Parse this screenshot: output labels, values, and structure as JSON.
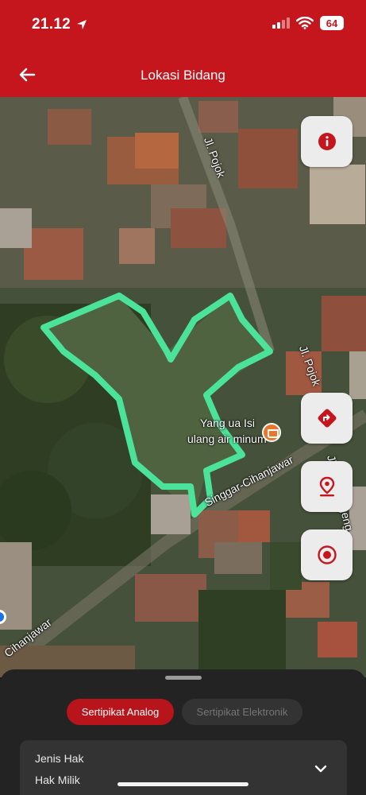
{
  "status_bar": {
    "time": "21.12",
    "battery": "64",
    "icons": [
      "location-arrow-icon",
      "signal-icon",
      "wifi-icon",
      "battery-icon"
    ]
  },
  "header": {
    "title": "Lokasi Bidang",
    "back_icon": "arrow-left-icon"
  },
  "map": {
    "labels": {
      "jl_pojok_top": "Jl. Pojok",
      "jl_pojok_right": "Jl. Pojok",
      "jl_nyangegeng": "Jl. Nyangegeng",
      "singgar": "Singgar-Cihanjawar",
      "cihanjawar": "Cihanjawar",
      "poi_line1": "Yang ua Isi",
      "poi_line2": "ulang air minum"
    },
    "buttons": [
      "info-icon",
      "directions-icon",
      "location-pin-icon",
      "target-icon"
    ],
    "colors": {
      "parcel_outline": "#4be39a",
      "button_icon": "#c5161d"
    }
  },
  "sheet": {
    "tabs": {
      "analog": "Sertipikat Analog",
      "elektronik": "Sertipikat Elektronik"
    },
    "card": {
      "label": "Jenis Hak",
      "value": "Hak Milik"
    }
  },
  "colors": {
    "brand": "#c5161d",
    "sheet_bg": "#232323"
  }
}
